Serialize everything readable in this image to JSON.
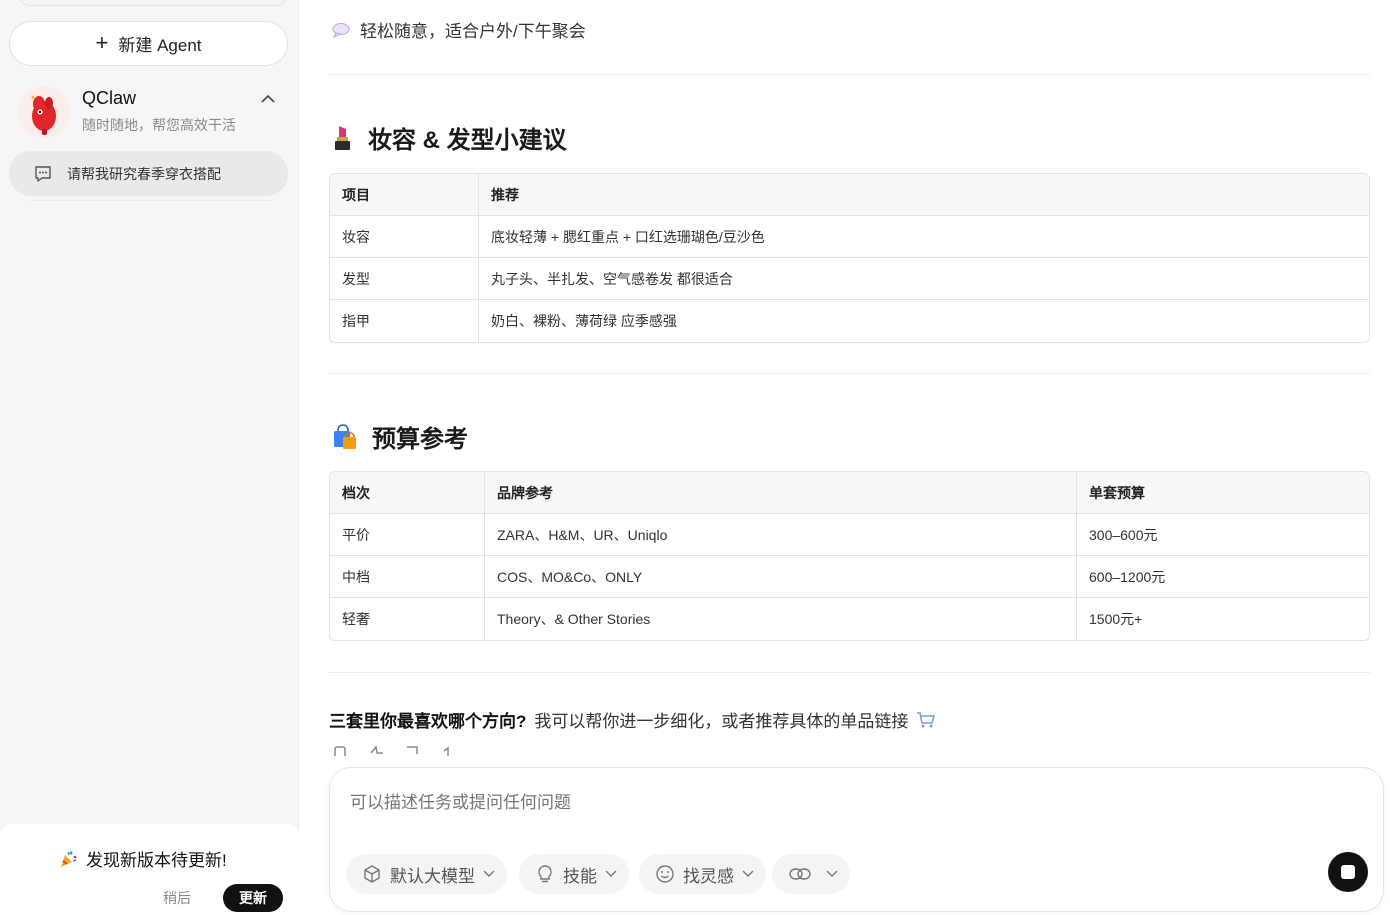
{
  "sidebar": {
    "new_agent_label": "新建 Agent",
    "agent": {
      "name": "QClaw",
      "subtitle": "随时随地，帮您高效干活"
    },
    "chat_items": [
      {
        "label": "请帮我研究春季穿衣搭配"
      }
    ],
    "update": {
      "title": "发现新版本待更新!",
      "later_label": "稍后",
      "update_label": "更新"
    }
  },
  "main": {
    "intro_line": "轻松随意，适合户外/下午聚会",
    "section_makeup": {
      "title": "妆容 & 发型小建议",
      "headers": [
        "项目",
        "推荐"
      ],
      "rows": [
        [
          "妆容",
          "底妆轻薄 + 腮红重点 + 口红选珊瑚色/豆沙色"
        ],
        [
          "发型",
          "丸子头、半扎发、空气感卷发 都很适合"
        ],
        [
          "指甲",
          "奶白、裸粉、薄荷绿 应季感强"
        ]
      ]
    },
    "section_budget": {
      "title": "预算参考",
      "headers": [
        "档次",
        "品牌参考",
        "单套预算"
      ],
      "rows": [
        [
          "平价",
          "ZARA、H&M、UR、Uniqlo",
          "300–600元"
        ],
        [
          "中档",
          "COS、MO&Co、ONLY",
          "600–1200元"
        ],
        [
          "轻奢",
          "Theory、& Other Stories",
          "1500元+"
        ]
      ]
    },
    "closing": {
      "bold": "三套里你最喜欢哪个方向?",
      "text": "我可以帮你进一步细化，或者推荐具体的单品链接"
    }
  },
  "composer": {
    "placeholder": "可以描述任务或提问任何问题",
    "model_label": "默认大模型",
    "skills_label": "技能",
    "inspiration_label": "找灵感"
  },
  "colors": {
    "sidebar_bg": "#f6f6f6",
    "active_item_bg": "#e9e9e9",
    "send_button": "#111111",
    "update_button": "#111111"
  }
}
